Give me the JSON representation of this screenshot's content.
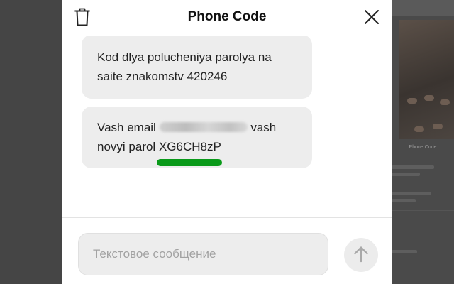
{
  "modal": {
    "title": "Phone Code",
    "icons": {
      "delete": "trash-icon",
      "close": "close-icon",
      "send": "arrow-up-icon"
    }
  },
  "messages": [
    {
      "text": "Kod dlya polucheniya parolya na saite znakomstv 420246"
    },
    {
      "prefix": "Vash email",
      "middle": "vash novyi parol",
      "password": "XG6CH8zP"
    }
  ],
  "composer": {
    "placeholder": "Текстовое сообщение",
    "value": ""
  },
  "background": {
    "card_title": "Phone Code"
  },
  "colors": {
    "highlight": "#0a9a1a",
    "bubble": "#ededed",
    "overlay": "#3e3e3e"
  }
}
